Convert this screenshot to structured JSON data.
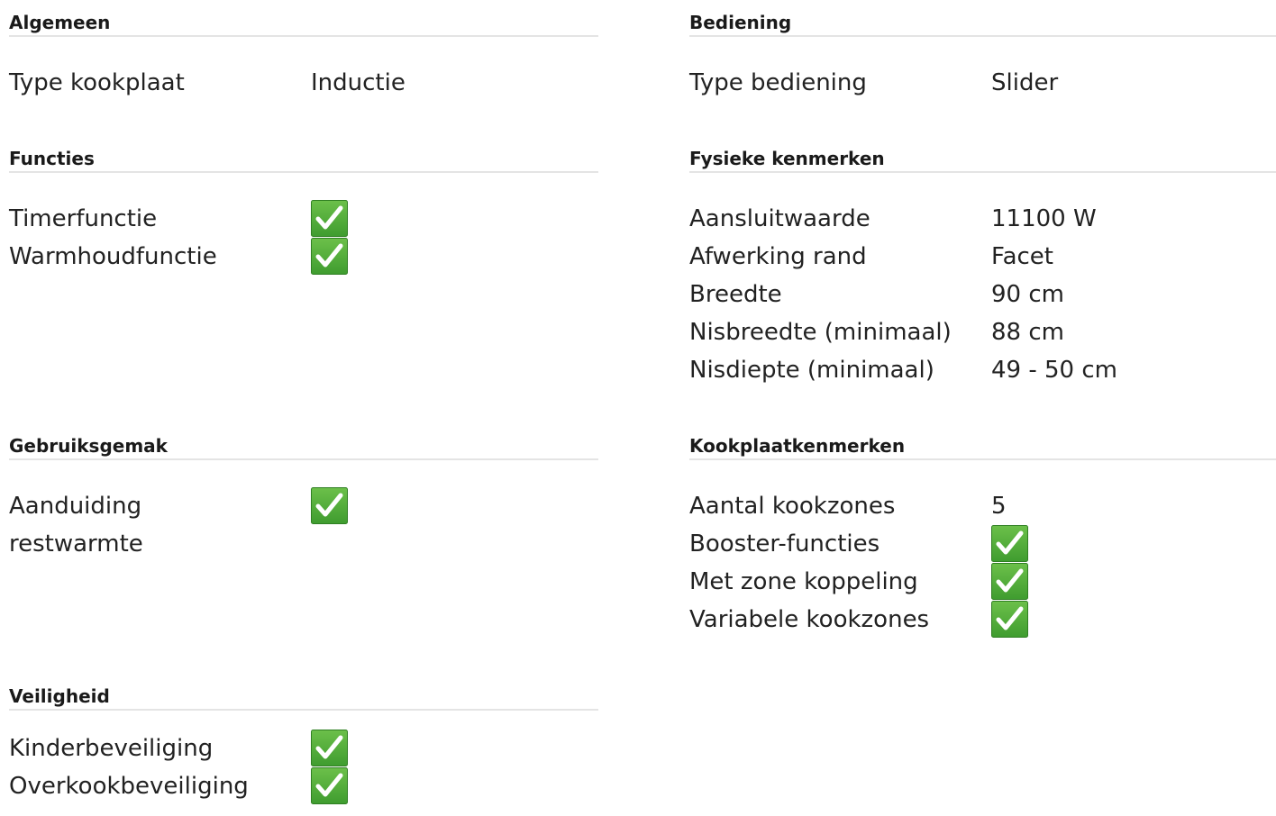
{
  "sections": {
    "algemeen": {
      "title": "Algemeen",
      "rows": [
        {
          "label": "Type kookplaat",
          "value": "Inductie"
        }
      ]
    },
    "bediening": {
      "title": "Bediening",
      "rows": [
        {
          "label": "Type bediening",
          "value": "Slider"
        }
      ]
    },
    "functies": {
      "title": "Functies",
      "rows": [
        {
          "label": "Timerfunctie",
          "value": "check-icon"
        },
        {
          "label": "Warmhoudfunctie",
          "value": "check-icon"
        }
      ]
    },
    "fysieke": {
      "title": "Fysieke kenmerken",
      "rows": [
        {
          "label": "Aansluitwaarde",
          "value": "11100 W"
        },
        {
          "label": "Afwerking rand",
          "value": "Facet"
        },
        {
          "label": "Breedte",
          "value": "90 cm"
        },
        {
          "label": "Nisbreedte (minimaal)",
          "value": "88 cm"
        },
        {
          "label": "Nisdiepte (minimaal)",
          "value": "49 - 50 cm"
        }
      ]
    },
    "gebruiksgemak": {
      "title": "Gebruiksgemak",
      "rows": [
        {
          "label": "Aanduiding restwarmte",
          "value": "check-icon"
        }
      ]
    },
    "kookplaat": {
      "title": "Kookplaatkenmerken",
      "rows": [
        {
          "label": "Aantal kookzones",
          "value": "5"
        },
        {
          "label": "Booster-functies",
          "value": "check-icon"
        },
        {
          "label": "Met zone koppeling",
          "value": "check-icon"
        },
        {
          "label": "Variabele kookzones",
          "value": "check-icon"
        }
      ]
    },
    "veiligheid": {
      "title": "Veiligheid",
      "rows": [
        {
          "label": "Kinderbeveiliging",
          "value": "check-icon"
        },
        {
          "label": "Overkookbeveiliging",
          "value": "check-icon"
        }
      ]
    }
  },
  "colors": {
    "check_green": "#3f9c2f",
    "check_green_light": "#6cc04a",
    "divider": "#e4e4e4"
  }
}
